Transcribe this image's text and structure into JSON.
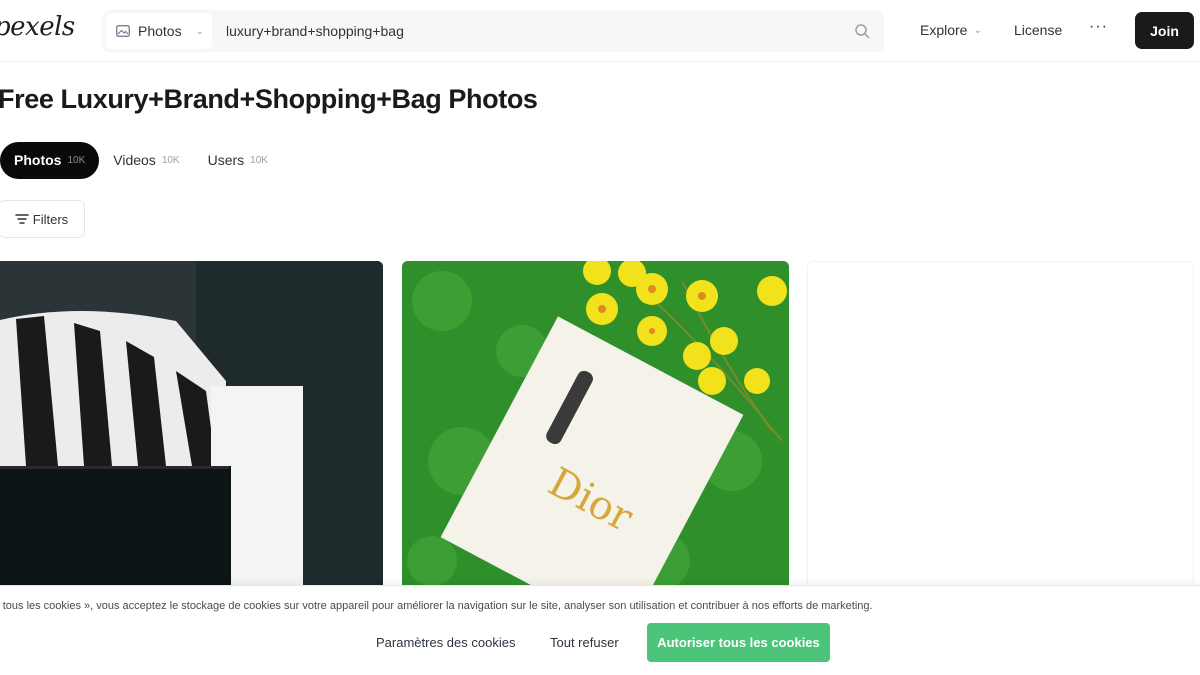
{
  "header": {
    "logo": "pexels",
    "search": {
      "type_label": "Photos",
      "type_icon": "image-icon",
      "query": "luxury+brand+shopping+bag"
    },
    "nav": {
      "explore": "Explore",
      "license": "License",
      "more": "···",
      "join": "Join"
    }
  },
  "main": {
    "title": "Free Luxury+Brand+Shopping+Bag Photos",
    "tabs": [
      {
        "label": "Photos",
        "count": "10K",
        "active": true
      },
      {
        "label": "Videos",
        "count": "10K",
        "active": false
      },
      {
        "label": "Users",
        "count": "10K",
        "active": false
      }
    ],
    "filters_label": "Filters",
    "photos": [
      {
        "subject": "black and white striped shopping bag with tissue paper",
        "accent": "#2a3436"
      },
      {
        "subject": "white Dior shopping bag on green grass with yellow flowers",
        "accent": "#2d8a2a",
        "bag_text": "Dior"
      },
      {
        "subject": "loading placeholder",
        "accent": "#ffffff"
      }
    ]
  },
  "cookie_banner": {
    "text": "r tous les cookies », vous acceptez le stockage de cookies sur votre appareil pour améliorer la navigation sur le site, analyser son utilisation et contribuer à nos efforts de marketing.",
    "settings": "Paramètres des cookies",
    "refuse": "Tout refuser",
    "accept": "Autoriser tous les cookies",
    "accept_color": "#4cc47a"
  }
}
